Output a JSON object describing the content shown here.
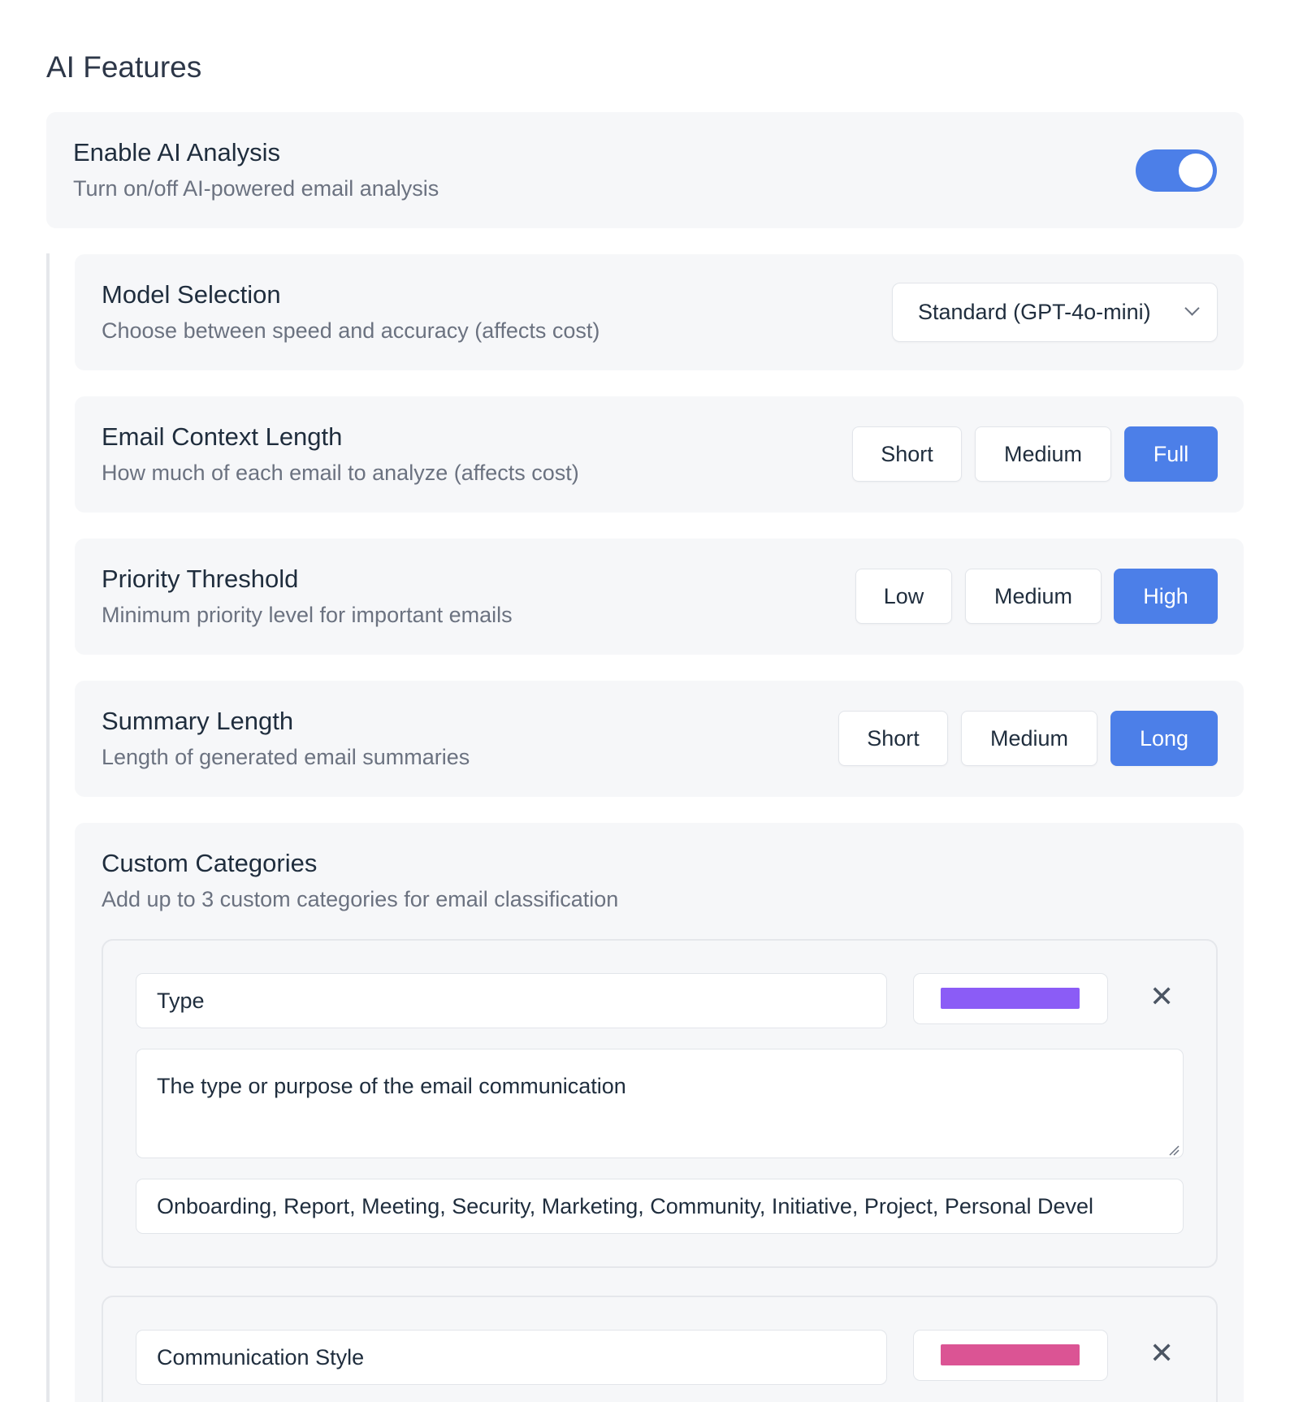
{
  "section": {
    "title": "AI Features"
  },
  "enable_ai": {
    "label": "Enable AI Analysis",
    "description": "Turn on/off AI-powered email analysis",
    "enabled": true
  },
  "model_selection": {
    "label": "Model Selection",
    "description": "Choose between speed and accuracy (affects cost)",
    "selected": "Standard (GPT-4o-mini)"
  },
  "context_length": {
    "label": "Email Context Length",
    "description": "How much of each email to analyze (affects cost)",
    "options": [
      "Short",
      "Medium",
      "Full"
    ],
    "selected": "Full"
  },
  "priority_threshold": {
    "label": "Priority Threshold",
    "description": "Minimum priority level for important emails",
    "options": [
      "Low",
      "Medium",
      "High"
    ],
    "selected": "High"
  },
  "summary_length": {
    "label": "Summary Length",
    "description": "Length of generated email summaries",
    "options": [
      "Short",
      "Medium",
      "Long"
    ],
    "selected": "Long"
  },
  "custom_categories": {
    "label": "Custom Categories",
    "description": "Add up to 3 custom categories for email classification",
    "items": [
      {
        "name": "Type",
        "color": "#8b5cf6",
        "description": "The type or purpose of the email communication",
        "values": "Onboarding, Report, Meeting, Security, Marketing, Community, Initiative, Project, Personal Devel"
      },
      {
        "name": "Communication Style",
        "color": "#db5494"
      }
    ]
  },
  "icons": {
    "remove": "close-icon",
    "dropdown": "chevron-down-icon"
  },
  "colors": {
    "accent": "#4c7fe8",
    "card_bg": "#f6f7f9"
  }
}
